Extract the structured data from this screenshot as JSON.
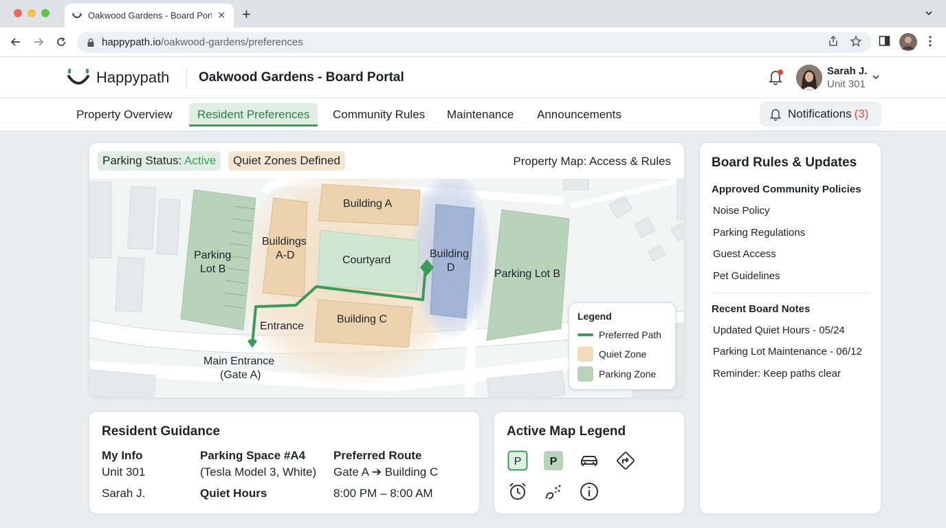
{
  "browser": {
    "tab_title": "Oakwood Gardens - Board Portal",
    "tab_close": "✕",
    "new_tab": "+",
    "url_host": "happypath.io",
    "url_path": "/oakwood-gardens/preferences"
  },
  "header": {
    "brand": "Happypath",
    "portal_title": "Oakwood Gardens - Board Portal",
    "user_name": "Sarah J.",
    "user_unit": "Unit 301"
  },
  "nav": {
    "tabs": [
      {
        "label": "Property Overview"
      },
      {
        "label": "Resident Preferences"
      },
      {
        "label": "Community Rules"
      },
      {
        "label": "Maintenance"
      },
      {
        "label": "Announcements"
      }
    ],
    "active_tab": "Resident Preferences",
    "notifications_label": "Notifications",
    "notifications_count": "(3)"
  },
  "map": {
    "parking_status_label": "Parking Status:",
    "parking_status_value": "Active",
    "quiet_zones": "Quiet Zones Defined",
    "title": "Property Map: Access & Rules",
    "labels": {
      "building_a": "Building A",
      "buildings_ad_1": "Buildings",
      "buildings_ad_2": "A-D",
      "courtyard": "Courtyard",
      "building_d_1": "Building",
      "building_d_2": "D",
      "building_c": "Building C",
      "parking_b_left_1": "Parking",
      "parking_b_left_2": "Lot B",
      "parking_b_right": "Parking Lot B",
      "entrance": "Entrance",
      "main_entrance_1": "Main Entrance",
      "main_entrance_2": "(Gate A)"
    },
    "legend": {
      "title": "Legend",
      "preferred_path": "Preferred Path",
      "quiet_zone": "Quiet Zone",
      "parking_zone": "Parking Zone"
    },
    "colors": {
      "path": "#3c9a5c",
      "quiet": "#f2dcbc",
      "parking": "#b9d3bb",
      "building_d_zone": "#bccce6"
    }
  },
  "sidebar": {
    "title": "Board Rules & Updates",
    "policies_heading": "Approved Community Policies",
    "policies": [
      {
        "label": "Noise Policy"
      },
      {
        "label": "Parking Regulations"
      },
      {
        "label": "Guest Access"
      },
      {
        "label": "Pet Guidelines"
      }
    ],
    "notes_heading": "Recent Board Notes",
    "notes": [
      {
        "label": "Updated Quiet Hours - 05/24"
      },
      {
        "label": "Parking Lot Maintenance - 06/12"
      },
      {
        "label": "Reminder: Keep paths clear"
      }
    ]
  },
  "guidance": {
    "title": "Resident Guidance",
    "my_info_label": "My Info",
    "unit": "Unit 301",
    "name": "Sarah J.",
    "parking_label": "Parking Space #A4",
    "vehicle": "(Tesla Model 3, White)",
    "quiet_hours_label": "Quiet Hours",
    "route_label": "Preferred Route",
    "route": "Gate A ➔ Building C",
    "quiet_hours": "8:00 PM – 8:00 AM"
  },
  "active_legend": {
    "title": "Active Map Legend",
    "icons": [
      "parking-outline-icon",
      "parking-filled-icon",
      "car-icon",
      "route-turn-icon",
      "alarm-clock-icon",
      "noise-icon",
      "info-icon"
    ]
  }
}
